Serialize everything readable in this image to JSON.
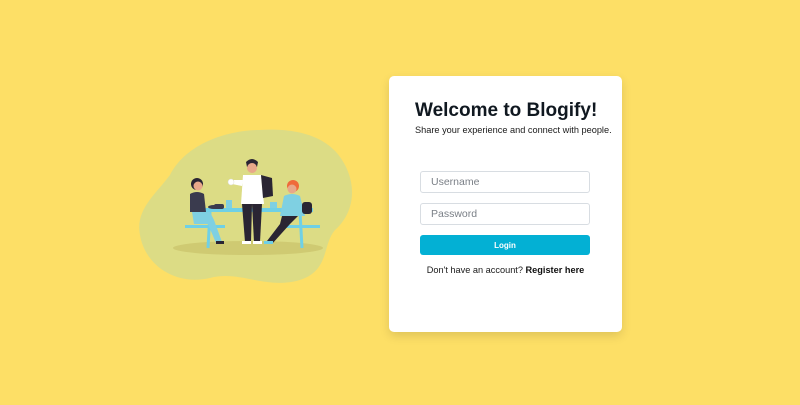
{
  "login": {
    "title": "Welcome to Blogify!",
    "subtitle": "Share your experience and connect with people.",
    "username_placeholder": "Username",
    "password_placeholder": "Password",
    "login_label": "Login",
    "register_prompt": "Don't have an account?",
    "register_link": "Register here"
  },
  "colors": {
    "background": "#fddf66",
    "accent": "#03b0d4",
    "blob": "#dcdc85",
    "card": "#ffffff"
  },
  "illustration": {
    "icon": "people-at-table-illustration"
  }
}
